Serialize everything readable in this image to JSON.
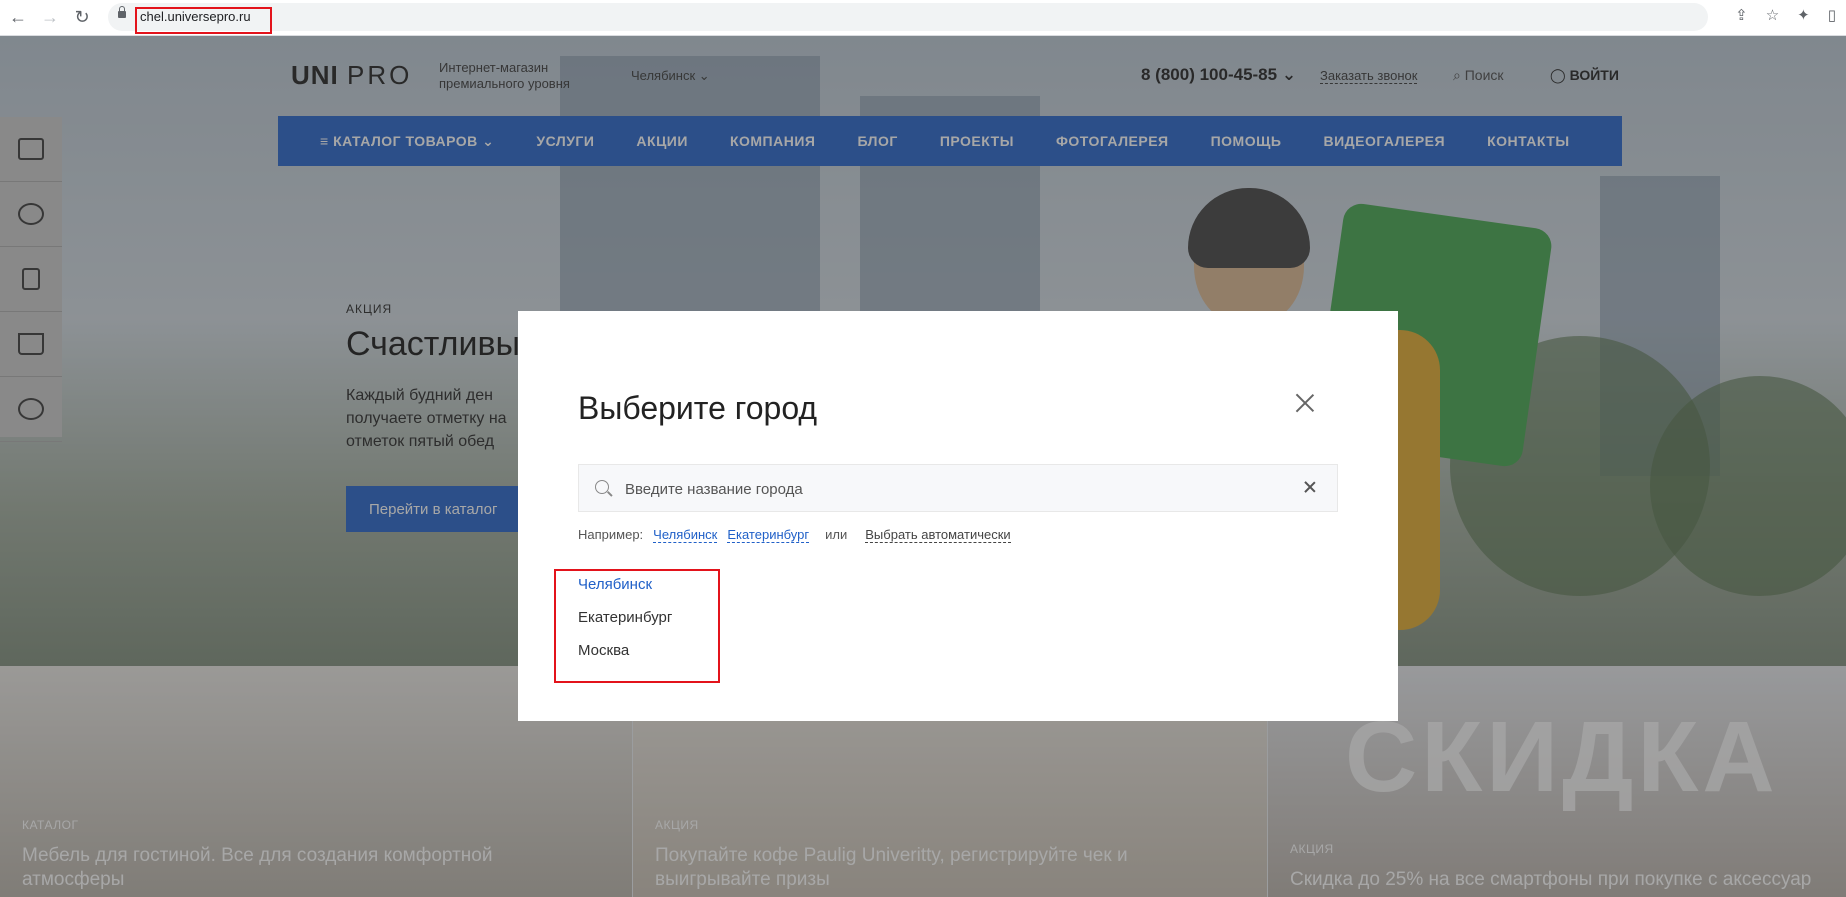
{
  "browser": {
    "url": "chel.universepro.ru"
  },
  "header": {
    "logo_main": "UNI",
    "logo_sub": "PRO",
    "tagline": "Интернет-магазин премиального уровня",
    "city": "Челябинск",
    "phone": "8 (800) 100-45-85",
    "callback": "Заказать звонок",
    "search": "Поиск",
    "login": "ВОЙТИ"
  },
  "nav": {
    "items": [
      "КАТАЛОГ ТОВАРОВ",
      "УСЛУГИ",
      "АКЦИИ",
      "КОМПАНИЯ",
      "БЛОГ",
      "ПРОЕКТЫ",
      "ФОТОГАЛЕРЕЯ",
      "ПОМОЩЬ",
      "ВИДЕОГАЛЕРЕЯ",
      "КОНТАКТЫ"
    ]
  },
  "hero": {
    "tag": "АКЦИЯ",
    "title": "Счастливы",
    "text": "Каждый будний ден получаете отметку на отметок пятый обед",
    "button": "Перейти в каталог"
  },
  "cards": [
    {
      "tag": "КАТАЛОГ",
      "title": "Мебель для гостиной. Все для создания комфортной атмосферы"
    },
    {
      "tag": "АКЦИЯ",
      "title": "Покупайте кофе Paulig Univeritty, регистрируйте чек и выигрывайте призы"
    },
    {
      "tag": "АКЦИЯ",
      "title": "Скидка до 25% на все смартфоны при покупке с аксессуар"
    }
  ],
  "card_overlay_text": "СКИДКА",
  "modal": {
    "title": "Выберите город",
    "search_placeholder": "Введите название города",
    "examples_label": "Например:",
    "examples": [
      "Челябинск",
      "Екатеринбург"
    ],
    "or": "или",
    "auto": "Выбрать автоматически",
    "cities": [
      "Челябинск",
      "Екатеринбург",
      "Москва"
    ],
    "active_city": "Челябинск"
  },
  "colors": {
    "accent": "#2060c8",
    "highlight": "#e3131b"
  }
}
